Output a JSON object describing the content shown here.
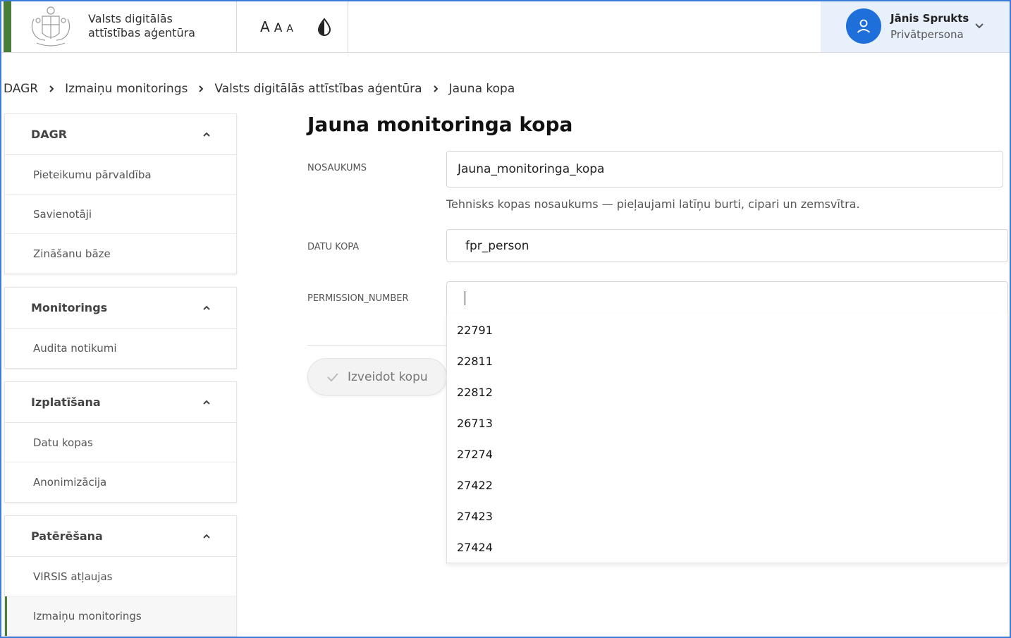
{
  "header": {
    "agency_line1": "Valsts digitālās",
    "agency_line2": "attīstības aģentūra",
    "font_sizes": [
      "A",
      "A",
      "A"
    ],
    "contrast_icon": "contrast-drop-icon",
    "brand_color": "#4a7c3a",
    "user": {
      "name": "Jānis Sprukts",
      "role": "Privātpersona",
      "avatar_icon": "user-icon",
      "avatar_color": "#1e6fd9"
    }
  },
  "breadcrumb": [
    "DAGR",
    "Izmaiņu monitorings",
    "Valsts digitālās attīstības aģentūra",
    "Jauna kopa"
  ],
  "sidebar": {
    "groups": [
      {
        "title": "DAGR",
        "items": [
          "Pieteikumu pārvaldība",
          "Savienotāji",
          "Zināšanu bāze"
        ]
      },
      {
        "title": "Monitorings",
        "items": [
          "Audita notikumi"
        ]
      },
      {
        "title": "Izplatīšana",
        "items": [
          "Datu kopas",
          "Anonimizācija"
        ]
      },
      {
        "title": "Patērēšana",
        "items": [
          "VIRSIS atļaujas",
          "Izmaiņu monitorings"
        ]
      }
    ],
    "active_item": "Izmaiņu monitorings"
  },
  "form": {
    "title": "Jauna monitoringa kopa",
    "name_label": "NOSAUKUMS",
    "name_value": "Jauna_monitoringa_kopa",
    "name_hint": "Tehnisks kopas nosaukums — pieļaujami latīņu burti, cipari un zemsvītra.",
    "dataset_label": "DATU KOPA",
    "dataset_value": "fpr_person",
    "permission_label": "PERMISSION_NUMBER",
    "permission_value": "",
    "permission_options": [
      "22791",
      "22811",
      "22812",
      "26713",
      "27274",
      "27422",
      "27423",
      "27424"
    ],
    "create_button": "Izveidot kopu"
  }
}
